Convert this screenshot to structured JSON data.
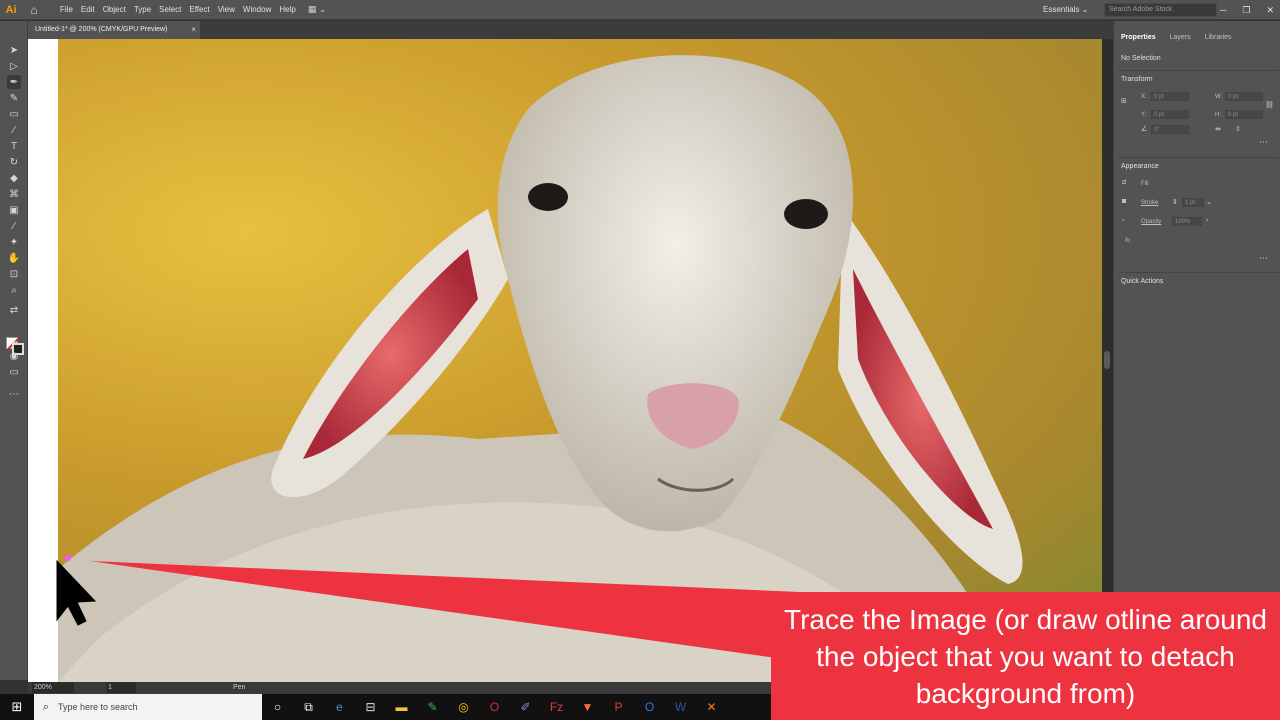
{
  "app": {
    "logo": "Ai"
  },
  "menu": [
    "File",
    "Edit",
    "Object",
    "Type",
    "Select",
    "Effect",
    "View",
    "Window",
    "Help"
  ],
  "workspace": {
    "label": "Essentials ⌄"
  },
  "stock_search": {
    "placeholder": "Search Adobe Stock"
  },
  "document_tab": {
    "title": "Untitled-1* @ 200% (CMYK/GPU Preview)",
    "close": "×"
  },
  "status": {
    "zoom": "200%",
    "page": "1",
    "tool": "Pen"
  },
  "properties_panel": {
    "tabs": [
      "Properties",
      "Layers",
      "Libraries"
    ],
    "no_selection": "No Selection",
    "transform": {
      "title": "Transform",
      "x_label": "X:",
      "y_label": "Y:",
      "w_label": "W:",
      "h_label": "H:",
      "x": "0 pt",
      "y": "0 pt",
      "w": "0 pt",
      "h": "0 pt",
      "angle": "0°"
    },
    "appearance": {
      "title": "Appearance",
      "fill": "Fill",
      "stroke": "Stroke",
      "stroke_weight": "1 pt",
      "opacity": "Opacity",
      "opacity_value": "100%",
      "fx": "fx."
    },
    "quick_actions": "Quick Actions"
  },
  "taskbar": {
    "search_placeholder": "Type here to search"
  },
  "callout": {
    "text": "Trace the Image (or draw otline around the object that you want to detach background from)",
    "color": "#ee3340"
  },
  "colors": {
    "ui_dark": "#535353",
    "artboard_bg": "#ffffff"
  }
}
